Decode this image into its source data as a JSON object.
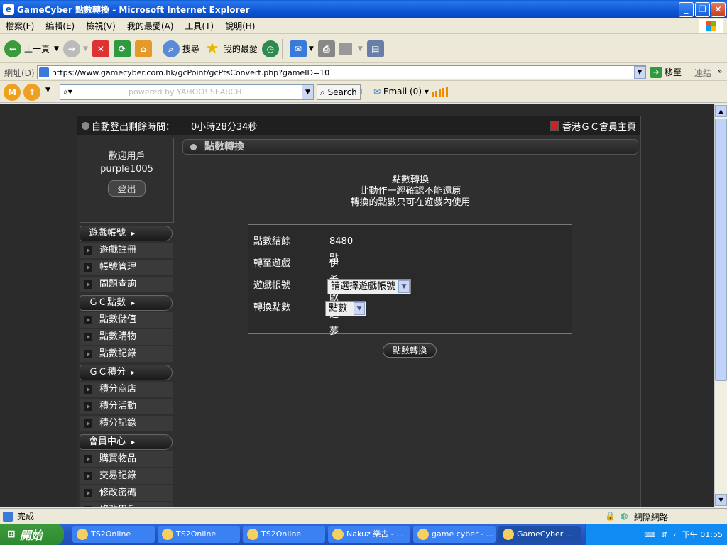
{
  "window": {
    "title": "GameCyber 點數轉換 - Microsoft Internet Explorer"
  },
  "menu": [
    "檔案(F)",
    "編輯(E)",
    "檢視(V)",
    "我的最愛(A)",
    "工具(T)",
    "說明(H)"
  ],
  "toolbar": {
    "back": "上一頁",
    "search": "搜尋",
    "favorites": "我的最愛"
  },
  "address": {
    "label": "網址(D)",
    "url": "https://www.gamecyber.com.hk/gcPoint/gcPtsConvert.php?gameID=10",
    "go": "移至",
    "links": "連結"
  },
  "yahoo": {
    "search_button": "Search",
    "email": "Email (0)",
    "placeholder": "powered by YAHOO! SEARCH"
  },
  "page": {
    "logout_timer_label": "自動登出剩餘時間：",
    "logout_timer_value": "0小時28分34秒",
    "member_home": "香港ＧＣ會員主頁",
    "welcome": "歡迎用戶",
    "username": "purple1005",
    "logout": "登出",
    "panel_title": "點數轉換",
    "notice": [
      "點數轉換",
      "此動作一經確認不能還原",
      "轉換的點數只可在遊戲內使用"
    ],
    "form": {
      "balance_label": "點數結餘",
      "balance_value": "8480點",
      "target_label": "轉至遊戲",
      "target_value": "伊希歐之夢",
      "account_label": "遊戲帳號",
      "account_select": "請選擇遊戲帳號",
      "amount_label": "轉換點數",
      "amount_select": "點數"
    },
    "convert_button": "點數轉換"
  },
  "sidebar": {
    "sections": [
      {
        "title": "遊戲帳號",
        "items": [
          "遊戲註冊",
          "帳號管理",
          "問題查詢"
        ]
      },
      {
        "title": "ＧＣ點數",
        "items": [
          "點數儲值",
          "點數購物",
          "點數記錄"
        ]
      },
      {
        "title": "ＧＣ積分",
        "items": [
          "積分商店",
          "積分活動",
          "積分記錄"
        ]
      },
      {
        "title": "會員中心",
        "items": [
          "購買物品",
          "交易記錄",
          "修改密碼",
          "修改用戶"
        ]
      }
    ]
  },
  "status": {
    "text": "完成",
    "zone": "網際網路"
  },
  "taskbar": {
    "start": "開始",
    "tasks": [
      "TS2Online",
      "TS2Online",
      "TS2Online",
      "Nakuz 樂古 - ...",
      "game cyber - ...",
      "GameCyber ..."
    ],
    "clock": "下午 01:55"
  },
  "colors": {
    "titlebar": "#0b56d6",
    "page_bg": "#2b2b2b",
    "taskbar": "#245edb"
  }
}
